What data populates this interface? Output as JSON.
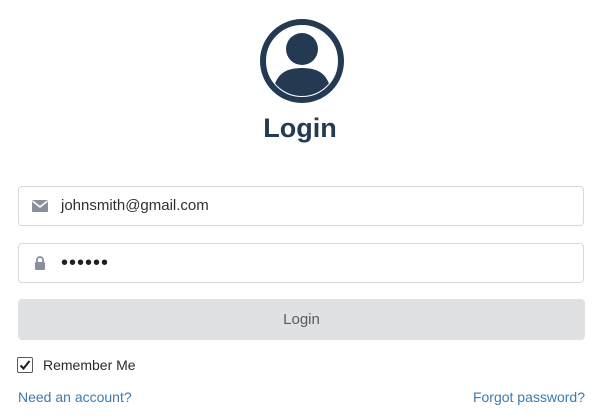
{
  "header": {
    "avatar_icon": "user-circle-icon",
    "title": "Login"
  },
  "form": {
    "email": {
      "icon": "envelope-icon",
      "value": "johnsmith@gmail.com"
    },
    "password": {
      "icon": "lock-icon",
      "value": "••••••"
    },
    "login_button_label": "Login",
    "remember_me": {
      "label": "Remember Me",
      "checked": true
    }
  },
  "links": {
    "need_account": "Need an account?",
    "forgot_password": "Forgot password?"
  },
  "colors": {
    "primary_dark": "#243a52",
    "link": "#3d7ab0",
    "button_bg": "#e0e1e2",
    "border": "#d7d9dc"
  }
}
